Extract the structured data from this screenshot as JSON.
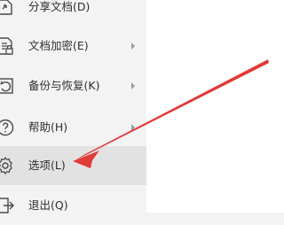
{
  "menu": {
    "items": [
      {
        "label": "分享文档(D)",
        "icon": "share-document-icon",
        "has_submenu": false
      },
      {
        "label": "文档加密(E)",
        "icon": "document-encrypt-icon",
        "has_submenu": true
      },
      {
        "label": "备份与恢复(K)",
        "icon": "backup-restore-icon",
        "has_submenu": true
      },
      {
        "label": "帮助(H)",
        "icon": "help-icon",
        "has_submenu": true
      },
      {
        "label": "选项(L)",
        "icon": "options-gear-icon",
        "has_submenu": false,
        "highlighted": true
      },
      {
        "label": "退出(Q)",
        "icon": "exit-icon",
        "has_submenu": false
      }
    ]
  },
  "annotation": {
    "type": "red-arrow",
    "color": "#e03a3a",
    "points_to": "选项(L)"
  },
  "colors": {
    "menu_bg": "#f3f3f3",
    "highlight_bg": "#e2e2e2",
    "icon": "#4a4a4a",
    "text": "#2e2e2e",
    "arrow": "#e03a3a"
  }
}
